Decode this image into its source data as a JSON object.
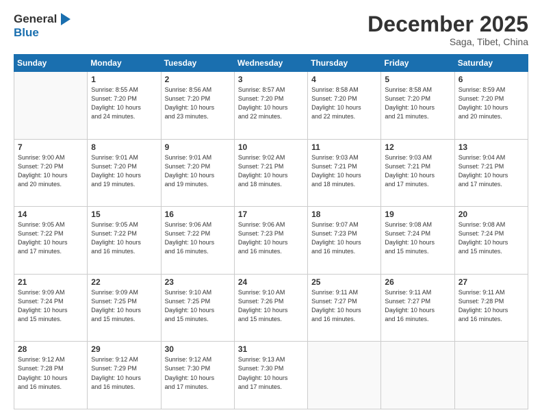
{
  "header": {
    "logo_general": "General",
    "logo_blue": "Blue",
    "month_title": "December 2025",
    "subtitle": "Saga, Tibet, China"
  },
  "weekdays": [
    "Sunday",
    "Monday",
    "Tuesday",
    "Wednesday",
    "Thursday",
    "Friday",
    "Saturday"
  ],
  "weeks": [
    [
      {
        "day": "",
        "info": ""
      },
      {
        "day": "1",
        "info": "Sunrise: 8:55 AM\nSunset: 7:20 PM\nDaylight: 10 hours\nand 24 minutes."
      },
      {
        "day": "2",
        "info": "Sunrise: 8:56 AM\nSunset: 7:20 PM\nDaylight: 10 hours\nand 23 minutes."
      },
      {
        "day": "3",
        "info": "Sunrise: 8:57 AM\nSunset: 7:20 PM\nDaylight: 10 hours\nand 22 minutes."
      },
      {
        "day": "4",
        "info": "Sunrise: 8:58 AM\nSunset: 7:20 PM\nDaylight: 10 hours\nand 22 minutes."
      },
      {
        "day": "5",
        "info": "Sunrise: 8:58 AM\nSunset: 7:20 PM\nDaylight: 10 hours\nand 21 minutes."
      },
      {
        "day": "6",
        "info": "Sunrise: 8:59 AM\nSunset: 7:20 PM\nDaylight: 10 hours\nand 20 minutes."
      }
    ],
    [
      {
        "day": "7",
        "info": "Sunrise: 9:00 AM\nSunset: 7:20 PM\nDaylight: 10 hours\nand 20 minutes."
      },
      {
        "day": "8",
        "info": "Sunrise: 9:01 AM\nSunset: 7:20 PM\nDaylight: 10 hours\nand 19 minutes."
      },
      {
        "day": "9",
        "info": "Sunrise: 9:01 AM\nSunset: 7:20 PM\nDaylight: 10 hours\nand 19 minutes."
      },
      {
        "day": "10",
        "info": "Sunrise: 9:02 AM\nSunset: 7:21 PM\nDaylight: 10 hours\nand 18 minutes."
      },
      {
        "day": "11",
        "info": "Sunrise: 9:03 AM\nSunset: 7:21 PM\nDaylight: 10 hours\nand 18 minutes."
      },
      {
        "day": "12",
        "info": "Sunrise: 9:03 AM\nSunset: 7:21 PM\nDaylight: 10 hours\nand 17 minutes."
      },
      {
        "day": "13",
        "info": "Sunrise: 9:04 AM\nSunset: 7:21 PM\nDaylight: 10 hours\nand 17 minutes."
      }
    ],
    [
      {
        "day": "14",
        "info": "Sunrise: 9:05 AM\nSunset: 7:22 PM\nDaylight: 10 hours\nand 17 minutes."
      },
      {
        "day": "15",
        "info": "Sunrise: 9:05 AM\nSunset: 7:22 PM\nDaylight: 10 hours\nand 16 minutes."
      },
      {
        "day": "16",
        "info": "Sunrise: 9:06 AM\nSunset: 7:22 PM\nDaylight: 10 hours\nand 16 minutes."
      },
      {
        "day": "17",
        "info": "Sunrise: 9:06 AM\nSunset: 7:23 PM\nDaylight: 10 hours\nand 16 minutes."
      },
      {
        "day": "18",
        "info": "Sunrise: 9:07 AM\nSunset: 7:23 PM\nDaylight: 10 hours\nand 16 minutes."
      },
      {
        "day": "19",
        "info": "Sunrise: 9:08 AM\nSunset: 7:24 PM\nDaylight: 10 hours\nand 15 minutes."
      },
      {
        "day": "20",
        "info": "Sunrise: 9:08 AM\nSunset: 7:24 PM\nDaylight: 10 hours\nand 15 minutes."
      }
    ],
    [
      {
        "day": "21",
        "info": "Sunrise: 9:09 AM\nSunset: 7:24 PM\nDaylight: 10 hours\nand 15 minutes."
      },
      {
        "day": "22",
        "info": "Sunrise: 9:09 AM\nSunset: 7:25 PM\nDaylight: 10 hours\nand 15 minutes."
      },
      {
        "day": "23",
        "info": "Sunrise: 9:10 AM\nSunset: 7:25 PM\nDaylight: 10 hours\nand 15 minutes."
      },
      {
        "day": "24",
        "info": "Sunrise: 9:10 AM\nSunset: 7:26 PM\nDaylight: 10 hours\nand 15 minutes."
      },
      {
        "day": "25",
        "info": "Sunrise: 9:11 AM\nSunset: 7:27 PM\nDaylight: 10 hours\nand 16 minutes."
      },
      {
        "day": "26",
        "info": "Sunrise: 9:11 AM\nSunset: 7:27 PM\nDaylight: 10 hours\nand 16 minutes."
      },
      {
        "day": "27",
        "info": "Sunrise: 9:11 AM\nSunset: 7:28 PM\nDaylight: 10 hours\nand 16 minutes."
      }
    ],
    [
      {
        "day": "28",
        "info": "Sunrise: 9:12 AM\nSunset: 7:28 PM\nDaylight: 10 hours\nand 16 minutes."
      },
      {
        "day": "29",
        "info": "Sunrise: 9:12 AM\nSunset: 7:29 PM\nDaylight: 10 hours\nand 16 minutes."
      },
      {
        "day": "30",
        "info": "Sunrise: 9:12 AM\nSunset: 7:30 PM\nDaylight: 10 hours\nand 17 minutes."
      },
      {
        "day": "31",
        "info": "Sunrise: 9:13 AM\nSunset: 7:30 PM\nDaylight: 10 hours\nand 17 minutes."
      },
      {
        "day": "",
        "info": ""
      },
      {
        "day": "",
        "info": ""
      },
      {
        "day": "",
        "info": ""
      }
    ]
  ]
}
